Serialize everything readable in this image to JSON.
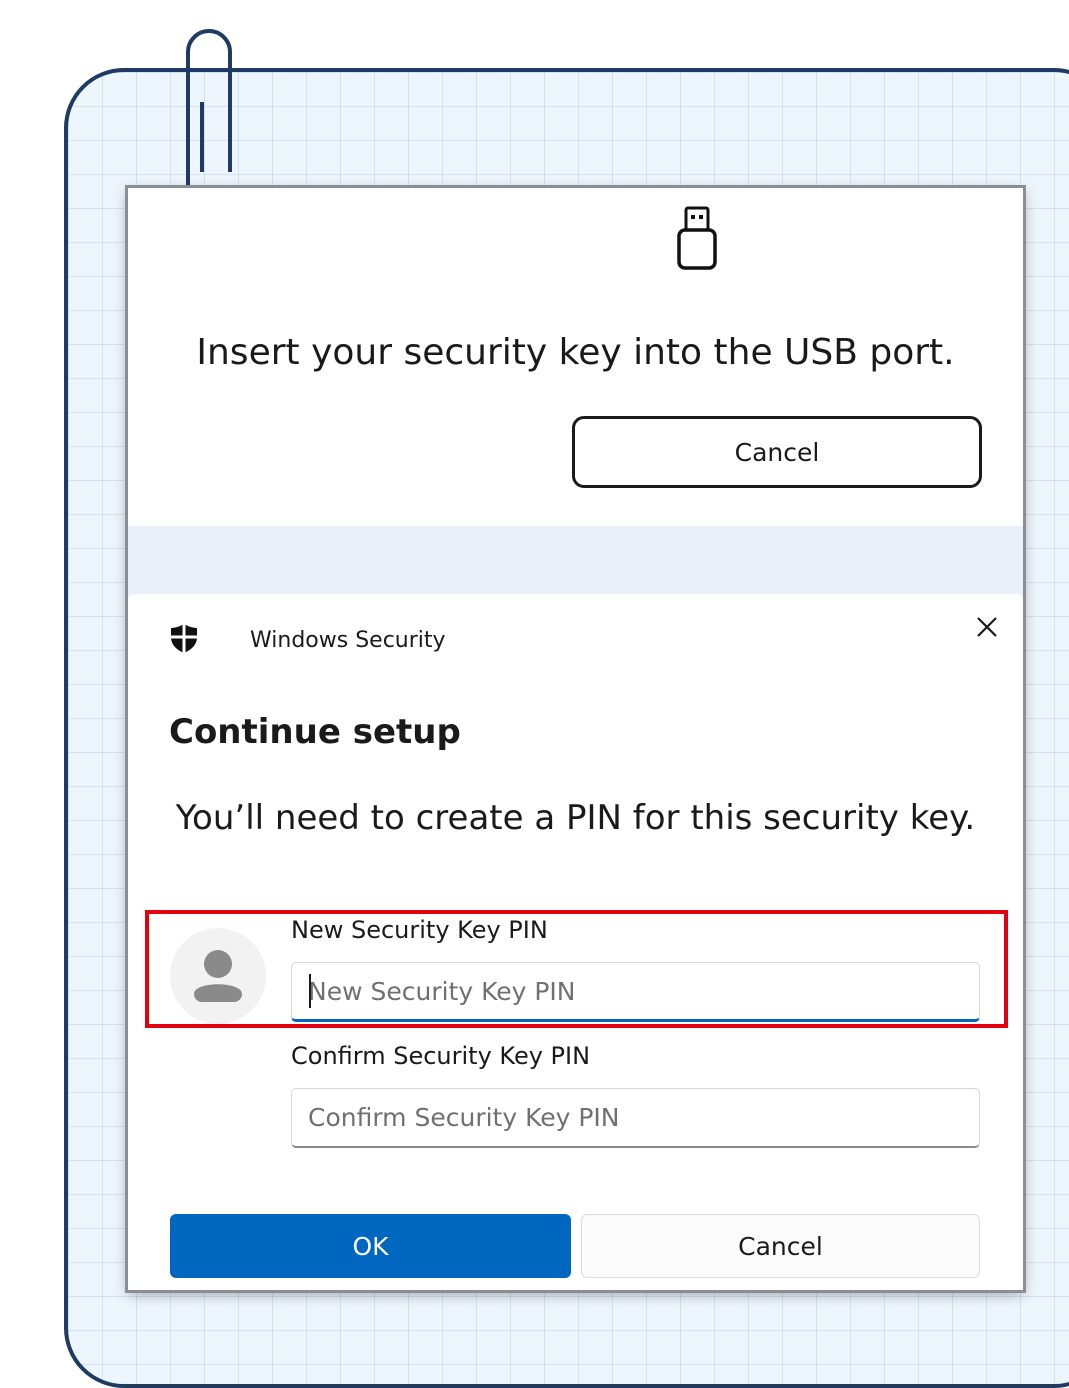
{
  "usb_prompt": {
    "icon": "usb-key-icon",
    "message": "Insert your security key into the USB port.",
    "cancel_label": "Cancel"
  },
  "dialog": {
    "app_icon": "shield-icon",
    "app_title": "Windows Security",
    "close_icon": "close-icon",
    "heading": "Continue setup",
    "message": "You’ll need to create a PIN for this security key.",
    "avatar_icon": "user-avatar-icon",
    "new_pin": {
      "label": "New Security Key PIN",
      "placeholder": "New Security Key PIN",
      "value": ""
    },
    "confirm_pin": {
      "label": "Confirm Security Key PIN",
      "placeholder": "Confirm Security Key PIN",
      "value": ""
    },
    "ok_label": "OK",
    "cancel_label": "Cancel"
  },
  "colors": {
    "accent": "#0067c0",
    "highlight": "#e3000f",
    "frame": "#1f3b63"
  }
}
